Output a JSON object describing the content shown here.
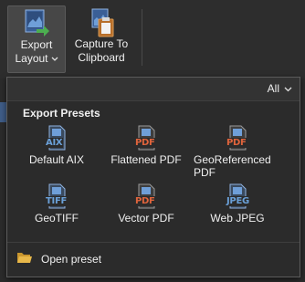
{
  "ribbon": {
    "export_layout": {
      "line1": "Export",
      "line2": "Layout",
      "icon": "export-layout-icon"
    },
    "capture_clipboard": {
      "line1": "Capture To",
      "line2": "Clipboard",
      "icon": "clipboard-capture-icon"
    }
  },
  "dropdown": {
    "filter_value": "All",
    "section_title": "Export Presets",
    "presets": [
      {
        "format": "AIX",
        "label": "Default AIX",
        "color": "#6aa0d8"
      },
      {
        "format": "PDF",
        "label": "Flattened PDF",
        "color": "#e0643c"
      },
      {
        "format": "PDF",
        "label": "GeoReferenced PDF",
        "color": "#e0643c"
      },
      {
        "format": "TIFF",
        "label": "GeoTIFF",
        "color": "#6aa0d8"
      },
      {
        "format": "PDF",
        "label": "Vector PDF",
        "color": "#e0643c"
      },
      {
        "format": "JPEG",
        "label": "Web JPEG",
        "color": "#6aa0d8"
      }
    ],
    "open_preset_label": "Open preset"
  },
  "colors": {
    "accent": "#3f7fd0",
    "folder": "#e8b84a",
    "background": "#2b2b2b"
  }
}
